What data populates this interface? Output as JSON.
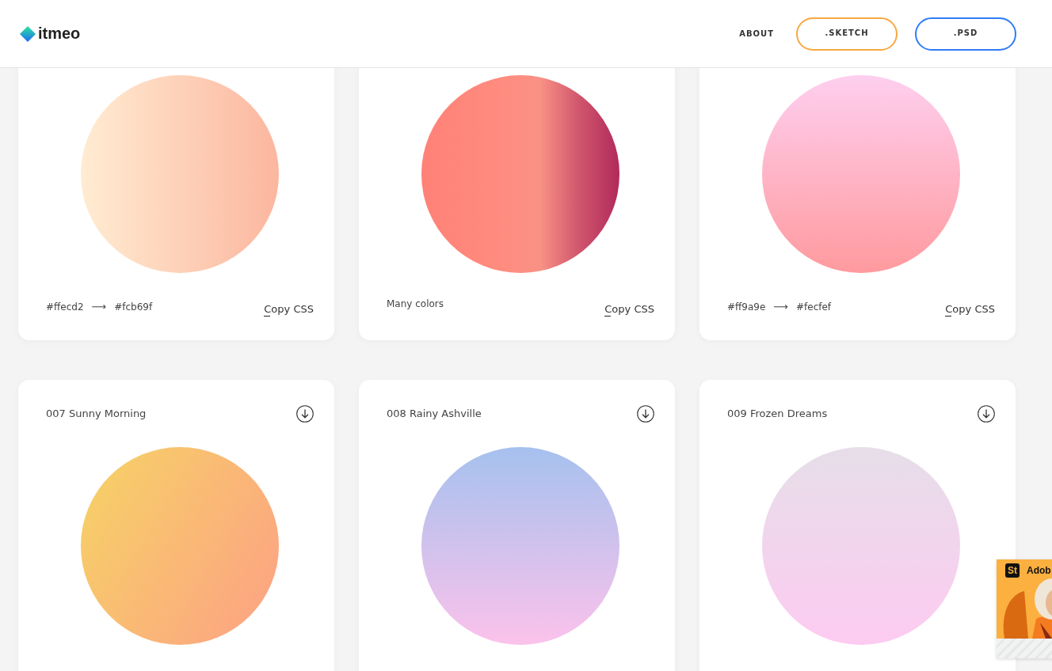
{
  "header": {
    "logo": "itmeo",
    "nav": [
      {
        "label": "ABOUT",
        "kind": "link"
      },
      {
        "label": ".SKETCH",
        "kind": "outline",
        "color": "#f7a843"
      },
      {
        "label": ".PSD",
        "kind": "outline",
        "color": "#2f7cf6"
      }
    ]
  },
  "cards": [
    {
      "kind": "horizontal",
      "stops": [
        {
          "color": "#ffecd2"
        },
        {
          "color": "#fcb69f"
        }
      ],
      "footer": {
        "kind": "pair",
        "from": "#ffecd2",
        "arrow": "⟶",
        "to": "#fcb69f"
      },
      "copy_label": "Copy CSS"
    },
    {
      "kind": "horizontal",
      "stops": [
        {
          "color": "#ff8177"
        },
        {
          "color": "#ff867a"
        },
        {
          "color": "#ff8c7f"
        },
        {
          "color": "#f99185"
        },
        {
          "color": "#cf556c"
        },
        {
          "color": "#b12a5b"
        }
      ],
      "footer": {
        "kind": "text",
        "text": "Many colors"
      },
      "copy_label": "Copy CSS"
    },
    {
      "kind": "vertical",
      "stops": [
        {
          "color": "#ff9a9e"
        },
        {
          "color": "#fecfef"
        }
      ],
      "footer": {
        "kind": "pair",
        "from": "#ff9a9e",
        "arrow": "⟶",
        "to": "#fecfef"
      },
      "copy_label": "Copy CSS"
    },
    {
      "title": "007 Sunny Morning",
      "kind": "diagonal",
      "stops": [
        {
          "color": "#f6d365"
        },
        {
          "color": "#fda085"
        }
      ]
    },
    {
      "title": "008 Rainy Ashville",
      "kind": "vertical",
      "stops": [
        {
          "color": "#fbc2eb"
        },
        {
          "color": "#a6c1ee"
        }
      ]
    },
    {
      "title": "009 Frozen Dreams",
      "kind": "vertical",
      "stops": [
        {
          "color": "#fdcbf1"
        },
        {
          "color": "#e6dee9"
        }
      ]
    }
  ],
  "ad": {
    "badge": "St",
    "text": "Adob"
  }
}
